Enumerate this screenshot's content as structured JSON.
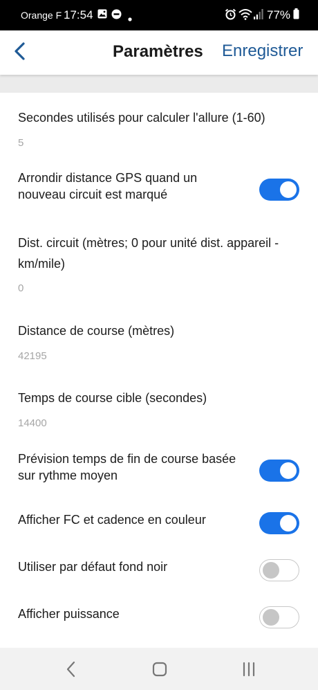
{
  "status_bar": {
    "carrier": "Orange F",
    "time": "17:54",
    "battery_pct": "77%"
  },
  "app_bar": {
    "title": "Paramètres",
    "save_label": "Enregistrer"
  },
  "settings": [
    {
      "label": "Secondes utilisés pour calculer l'allure (1-60)",
      "value": "5"
    },
    {
      "label": "Arrondir distance GPS quand un nouveau circuit est marqué",
      "toggle": true
    },
    {
      "label": "Dist. circuit (mètres; 0 pour unité dist. appareil - km/mile)",
      "value": "0"
    },
    {
      "label": "Distance de course (mètres)",
      "value": "42195"
    },
    {
      "label": "Temps de course cible (secondes)",
      "value": "14400"
    },
    {
      "label": "Prévision temps de fin de course basée sur rythme moyen",
      "toggle": true
    },
    {
      "label": "Afficher FC et cadence en couleur",
      "toggle": true
    },
    {
      "label": "Utiliser par défaut fond noir",
      "toggle": false
    },
    {
      "label": "Afficher puissance",
      "toggle": false
    }
  ],
  "colors": {
    "accent": "#1a73e8",
    "link": "#1f5a96",
    "value_text": "#a6a6a6"
  }
}
